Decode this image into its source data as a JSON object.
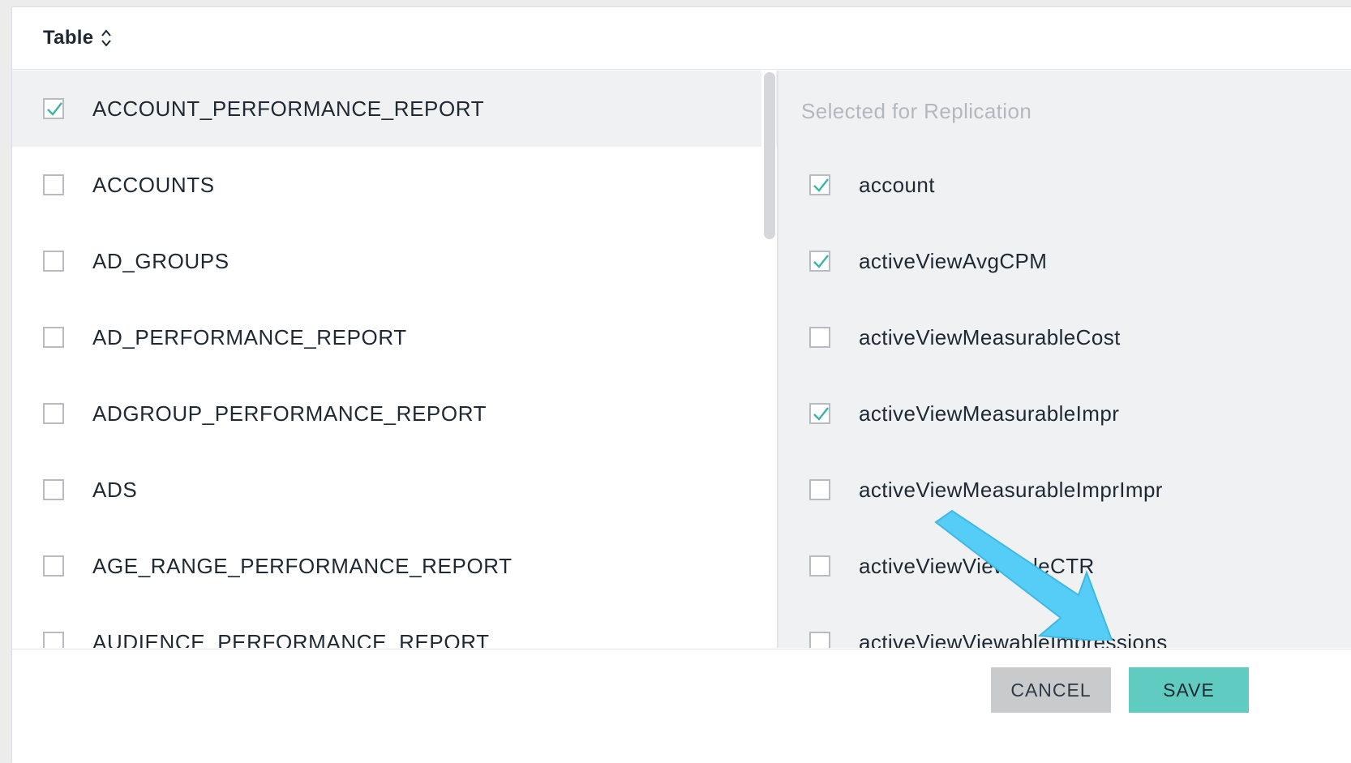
{
  "header": {
    "title": "Table",
    "sort_icon": "chevron-up-down-icon"
  },
  "tables": [
    {
      "label": "ACCOUNT_PERFORMANCE_REPORT",
      "checked": true
    },
    {
      "label": "ACCOUNTS",
      "checked": false
    },
    {
      "label": "AD_GROUPS",
      "checked": false
    },
    {
      "label": "AD_PERFORMANCE_REPORT",
      "checked": false
    },
    {
      "label": "ADGROUP_PERFORMANCE_REPORT",
      "checked": false
    },
    {
      "label": "ADS",
      "checked": false
    },
    {
      "label": "AGE_RANGE_PERFORMANCE_REPORT",
      "checked": false
    },
    {
      "label": "AUDIENCE_PERFORMANCE_REPORT",
      "checked": false
    }
  ],
  "fields_panel": {
    "heading": "Selected for Replication",
    "fields": [
      {
        "label": "account",
        "checked": true
      },
      {
        "label": "activeViewAvgCPM",
        "checked": true
      },
      {
        "label": "activeViewMeasurableCost",
        "checked": false
      },
      {
        "label": "activeViewMeasurableImpr",
        "checked": true
      },
      {
        "label": "activeViewMeasurableImprImpr",
        "checked": false
      },
      {
        "label": "activeViewViewableCTR",
        "checked": false
      },
      {
        "label": "activeViewViewableImpressions",
        "checked": false
      }
    ]
  },
  "footer": {
    "cancel_label": "CANCEL",
    "save_label": "SAVE"
  },
  "colors": {
    "accent": "#5fcbc1",
    "check": "#3bb3a6",
    "annotation_arrow": "#56cdf6"
  }
}
